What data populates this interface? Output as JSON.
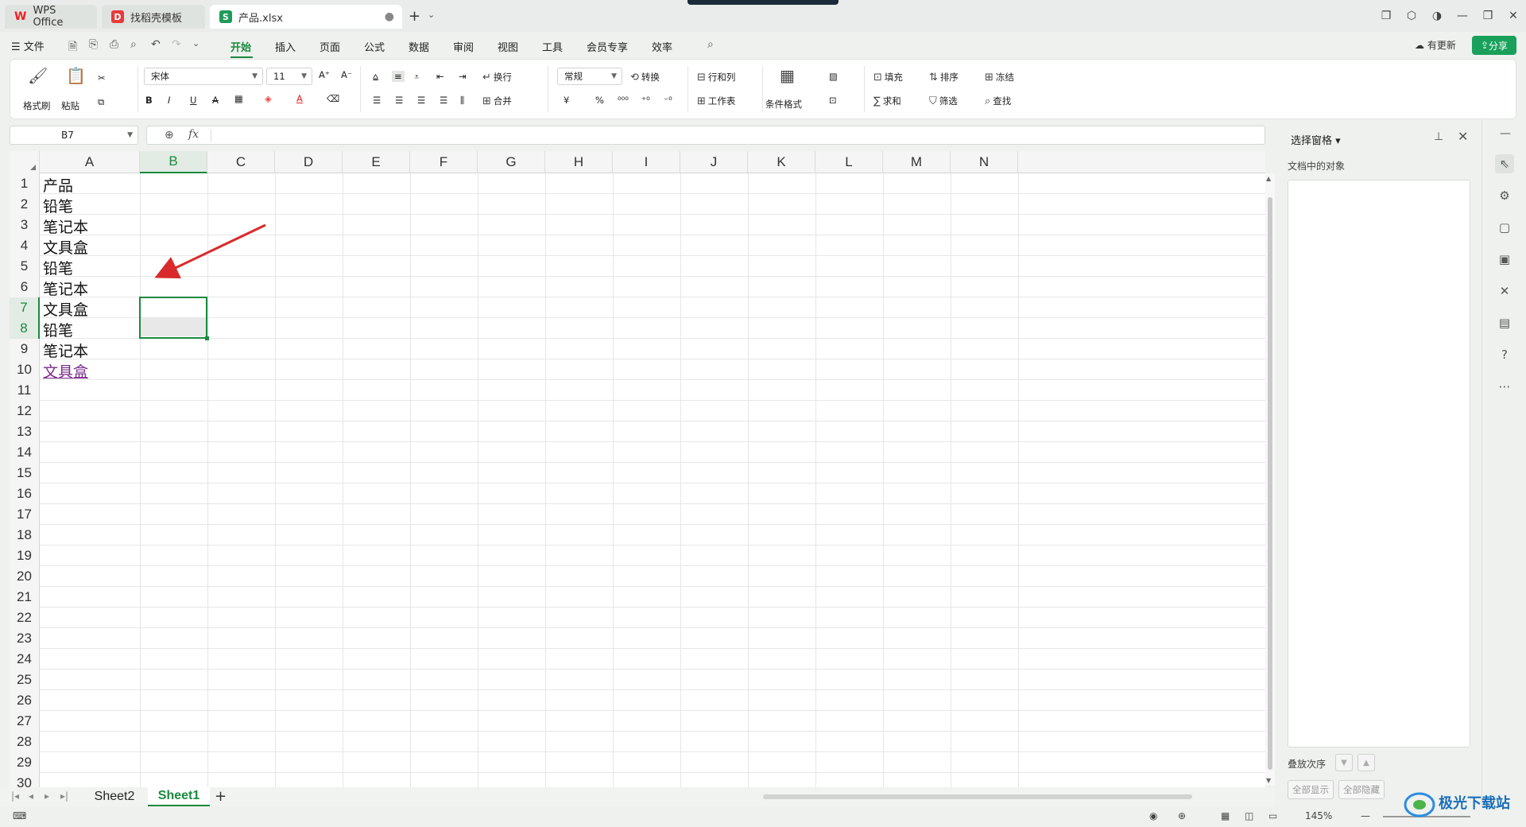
{
  "title_tabs": {
    "wps": "WPS Office",
    "templates": "找稻壳模板",
    "file": "产品.xlsx",
    "file_close": "●"
  },
  "menu": {
    "file": "☰ 文件",
    "tabs": [
      "开始",
      "插入",
      "页面",
      "公式",
      "数据",
      "审阅",
      "视图",
      "工具",
      "会员专享",
      "效率"
    ],
    "active_tab": "开始",
    "update": "有更新",
    "share": "分享"
  },
  "ribbon": {
    "format_painter": "格式刷",
    "paste": "粘贴",
    "font_name": "宋体",
    "font_size": "11",
    "wrap": "换行",
    "merge": "合并",
    "number_format": "常规",
    "convert": "转换",
    "row_col": "行和列",
    "worksheet": "工作表",
    "cond_format": "条件格式",
    "fill": "填充",
    "sort": "排序",
    "freeze": "冻结",
    "sum": "求和",
    "filter": "筛选",
    "find": "查找"
  },
  "formula_bar": {
    "cell_ref": "B7",
    "fx": "fx",
    "value": ""
  },
  "columns": [
    "A",
    "B",
    "C",
    "D",
    "E",
    "F",
    "G",
    "H",
    "I",
    "J",
    "K",
    "L",
    "M",
    "N"
  ],
  "selected_column": "B",
  "rows": [
    "1",
    "2",
    "3",
    "4",
    "5",
    "6",
    "7",
    "8",
    "9",
    "10",
    "11",
    "12",
    "13",
    "14",
    "15",
    "16",
    "17",
    "18",
    "19",
    "20",
    "21",
    "22",
    "23",
    "24",
    "25",
    "26",
    "27",
    "28",
    "29",
    "30"
  ],
  "selected_rows": [
    "7",
    "8"
  ],
  "cells_a": [
    "产品",
    "铅笔",
    "笔记本",
    "文具盒",
    "铅笔",
    "笔记本",
    "文具盒",
    "铅笔",
    "笔记本",
    "文具盒"
  ],
  "annotation_color": "#d92b2b",
  "sheets": {
    "tabs": [
      "Sheet2",
      "Sheet1"
    ],
    "active": "Sheet1",
    "add": "+"
  },
  "status": {
    "zoom": "145%"
  },
  "selection_pane": {
    "title": "选择窗格",
    "subtitle": "文档中的对象",
    "order_label": "叠放次序",
    "show_all": "全部显示",
    "hide_all": "全部隐藏"
  },
  "watermark": {
    "text": "极光下载站"
  },
  "accent_color": "#1a8a3f"
}
